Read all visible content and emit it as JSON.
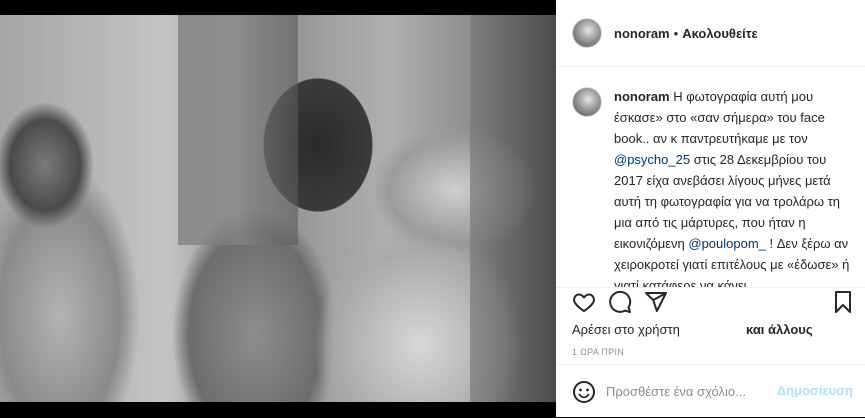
{
  "post": {
    "username": "nonoram",
    "separator": "•",
    "follow_label": "Ακολουθείτε",
    "photo_alt": ""
  },
  "caption": {
    "username": "nonoram",
    "part1": " Η φωτογραφία αυτή μου έσκασε» στο «σαν σήμερα» του face book.. αν κ παντρευτήκαμε με τον ",
    "mention1": "@psycho_25",
    "part2": " στις 28 Δεκεμβρίου του 2017 είχα ανεβάσει λίγους μήνες μετά αυτή τη φωτογραφία για να τρολάρω τη μια από τις μάρτυρες, που ήταν η εικονιζόμενη ",
    "mention2": "@poulopom_",
    "part3": " ! Δεν ξέρω αν χειροκροτεί γιατί επιτέλους με «έδωσε» ή γιατί κατάφερε να κάνει"
  },
  "actions": {
    "like_icon": "heart-icon",
    "comment_icon": "comment-icon",
    "share_icon": "share-icon",
    "save_icon": "bookmark-icon"
  },
  "likes": {
    "prefix": "Αρέσει στο χρήστη",
    "others": "και άλλους"
  },
  "time_label": "1 ΩΡΑ ΠΡΙΝ",
  "comment": {
    "placeholder": "Προσθέστε ένα σχόλιο...",
    "post_label": "Δημοσίευση",
    "emoji_icon": "emoji-icon"
  },
  "colors": {
    "link": "#00376b",
    "post_button_disabled": "#b2dffc",
    "meta": "#8e8e8e"
  }
}
